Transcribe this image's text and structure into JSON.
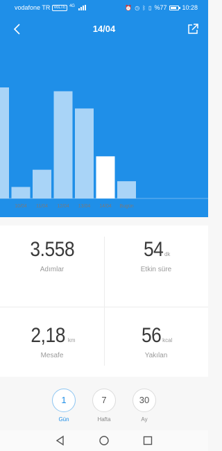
{
  "status_bar": {
    "carrier": "vodafone TR",
    "volte": "VoLTE",
    "network": "4G",
    "battery": "%77",
    "time": "10:28"
  },
  "header": {
    "title": "14/04"
  },
  "chart_data": {
    "type": "bar",
    "categories": [
      "",
      "10/04",
      "11/04",
      "12/04",
      "13/04",
      "14/04",
      "Bugün"
    ],
    "values": [
      5800,
      600,
      1500,
      5600,
      4700,
      2200,
      900
    ],
    "selected_index": 5,
    "colors": {
      "bar": "#a9d4f7",
      "selected": "#ffffff",
      "background": "#1f8fe8"
    }
  },
  "stats": {
    "steps": {
      "value": "3.558",
      "label": "Adımlar"
    },
    "active_time": {
      "value": "54",
      "unit": "dk",
      "label": "Etkin süre"
    },
    "distance": {
      "value": "2,18",
      "unit": "km",
      "label": "Mesafe"
    },
    "calories": {
      "value": "56",
      "unit": "kcal",
      "label": "Yakılan"
    }
  },
  "period_tabs": [
    {
      "value": "1",
      "label": "Gün"
    },
    {
      "value": "7",
      "label": "Hafta"
    },
    {
      "value": "30",
      "label": "Ay"
    }
  ],
  "colors": {
    "accent": "#1f8fe8"
  }
}
